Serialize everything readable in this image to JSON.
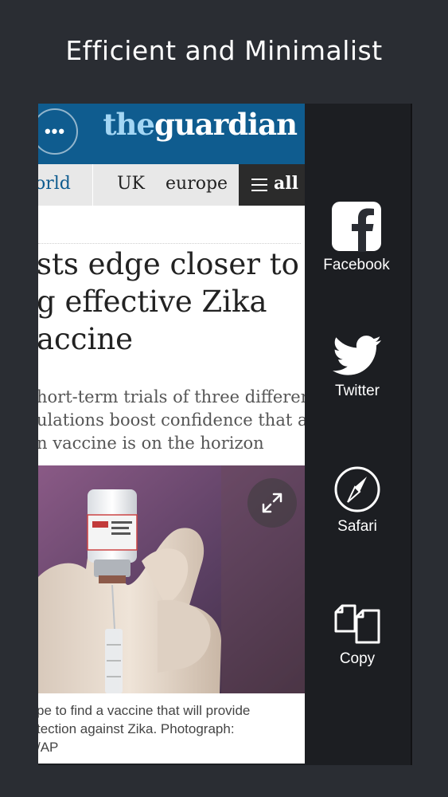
{
  "promo": {
    "headline": "Efficient and Minimalist"
  },
  "article_card": {
    "header": {
      "menu_icon": "ellipsis-icon",
      "logo_prefix": "the",
      "logo_suffix": "guardian"
    },
    "nav": {
      "items": [
        {
          "label": "orld"
        },
        {
          "label": "UK"
        },
        {
          "label": "europe"
        }
      ],
      "all_label": "all",
      "all_icon": "hamburger-icon"
    },
    "title": "sts edge closer to\ng effective Zika\naccine",
    "standfirst": "hort-term trials of three different\nulations boost confidence that a\nn vaccine is on the horizon",
    "image": {
      "expand_icon": "expand-icon",
      "description": "hand holding vaccine vial and syringe"
    },
    "caption": "pe to find a vaccine that will provide\ntection against Zika. Photograph:\n/AP"
  },
  "share_panel": {
    "items": [
      {
        "label": "Facebook",
        "icon": "facebook-icon"
      },
      {
        "label": "Twitter",
        "icon": "twitter-icon"
      },
      {
        "label": "Safari",
        "icon": "safari-compass-icon"
      },
      {
        "label": "Copy",
        "icon": "copy-icon"
      }
    ]
  },
  "colors": {
    "background": "#2a2d33",
    "guardian_blue": "#0f5c8f",
    "guardian_light_blue": "#a3d6f4",
    "nav_background": "#e8e8e8",
    "nav_all_background": "#2b2b2b"
  }
}
